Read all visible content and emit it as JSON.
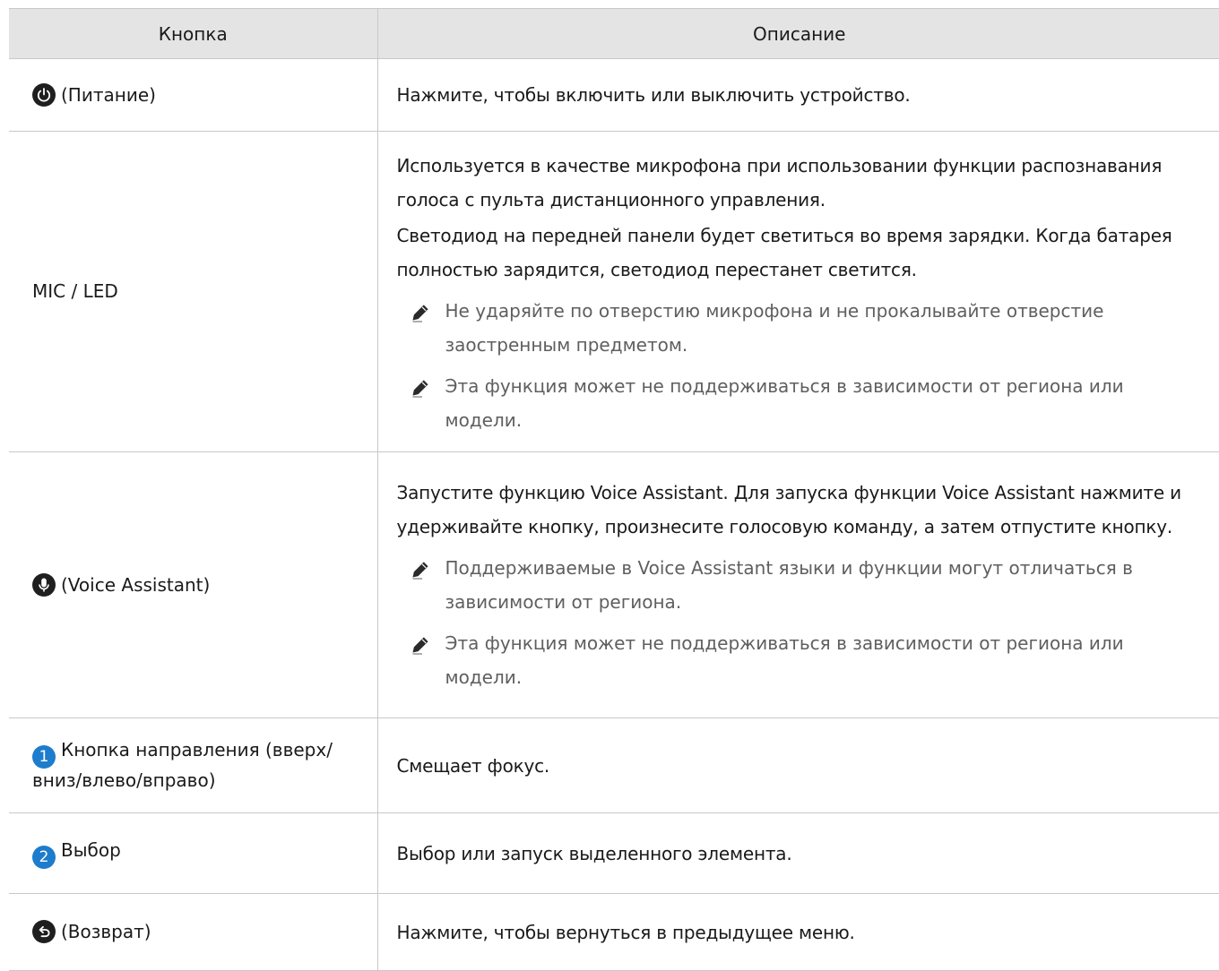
{
  "table": {
    "headers": {
      "button": "Кнопка",
      "description": "Описание"
    },
    "rows": [
      {
        "icon": "power-icon",
        "button": "(Питание)",
        "description": [
          "Нажмите, чтобы включить или выключить устройство."
        ],
        "notes": []
      },
      {
        "icon": "",
        "button": "MIC / LED",
        "description": [
          "Используется в качестве микрофона при использовании функции распознавания голоса с пульта дистанционного управления.",
          "Светодиод на передней панели будет светиться во время зарядки. Когда батарея полностью зарядится, светодиод перестанет светится."
        ],
        "notes": [
          "Не ударяйте по отверстию микрофона и не прокалывайте отверстие заостренным предметом.",
          "Эта функция может не поддерживаться в зависимости от региона или модели."
        ]
      },
      {
        "icon": "microphone-icon",
        "button": "(Voice Assistant)",
        "description": [
          "Запустите функцию Voice Assistant. Для запуска функции Voice Assistant нажмите и удерживайте кнопку, произнесите голосовую команду, а затем отпустите кнопку."
        ],
        "notes": [
          "Поддерживаемые в Voice Assistant языки и функции могут отличаться в зависимости от региона.",
          "Эта функция может не поддерживаться в зависимости от региона или модели."
        ]
      },
      {
        "icon": "number-1-icon",
        "badge": "1",
        "button": "Кнопка направления (вверх/ вниз/влево/вправо)",
        "description": [
          "Смещает фокус."
        ],
        "notes": []
      },
      {
        "icon": "number-2-icon",
        "badge": "2",
        "button": "Выбор",
        "description": [
          "Выбор или запуск выделенного элемента."
        ],
        "notes": []
      },
      {
        "icon": "return-icon",
        "button": "(Возврат)",
        "description": [
          "Нажмите, чтобы вернуться в предыдущее меню."
        ],
        "notes": []
      }
    ]
  },
  "colors": {
    "header_bg": "#e4e4e4",
    "badge_blue": "#1e7ccc",
    "icon_dark": "#1f1f1f",
    "note_text": "#5f5f5f"
  }
}
